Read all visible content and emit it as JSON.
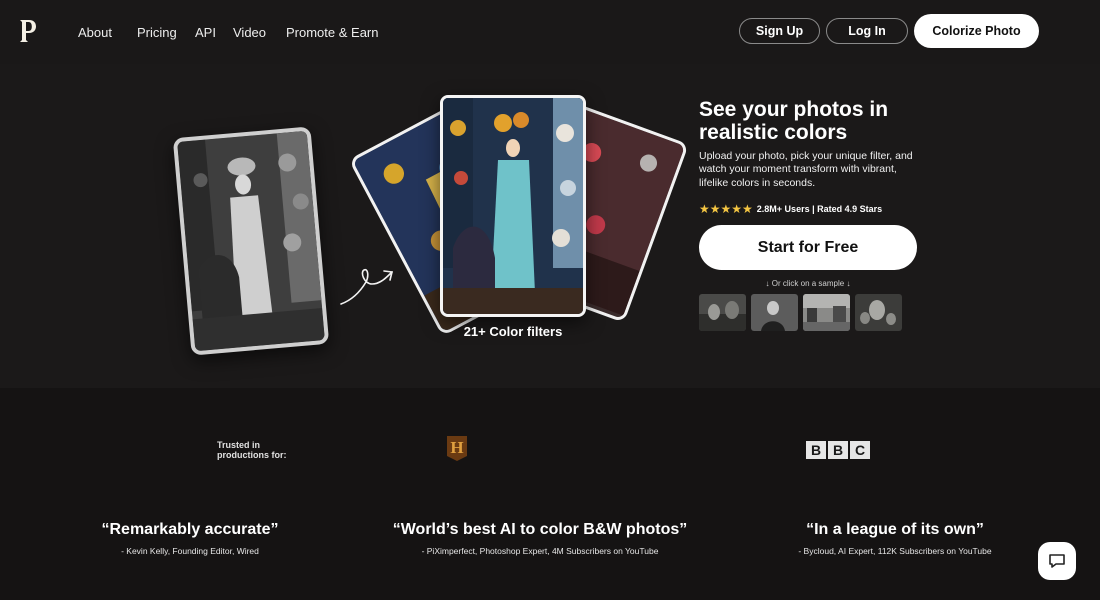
{
  "header": {
    "logo_letter": "P",
    "nav": [
      "About",
      "Pricing",
      "API",
      "Video",
      "Promote & Earn"
    ],
    "sign_up": "Sign Up",
    "log_in": "Log In",
    "colorize": "Colorize Photo"
  },
  "hero": {
    "title": "See your photos in realistic colors",
    "description": "Upload your photo, pick your unique filter, and watch your moment transform with vibrant, lifelike colors in seconds.",
    "stars": "★★★★★",
    "rating_text": "2.8M+ Users | Rated 4.9 Stars",
    "cta": "Start for Free",
    "sample_note": "↓ Or click on a sample ↓",
    "filters_label": "21+ Color filters"
  },
  "trusted": {
    "label": "Trusted in productions for:",
    "history_letter": "H",
    "bbc": [
      "B",
      "B",
      "C"
    ]
  },
  "quotes": [
    {
      "text": "“Remarkably accurate”",
      "author": "- Kevin Kelly, Founding Editor, Wired"
    },
    {
      "text": "“World’s best AI to color B&W photos”",
      "author": "- PiXimperfect, Photoshop Expert, 4M Subscribers on YouTube"
    },
    {
      "text": "“In a league of its own”",
      "author": "- Bycloud, AI Expert, 112K Subscribers on YouTube"
    }
  ],
  "colors": {
    "background": "#1a1818",
    "lower_background": "#151313",
    "star": "#f4c542",
    "button": "#ffffff"
  }
}
